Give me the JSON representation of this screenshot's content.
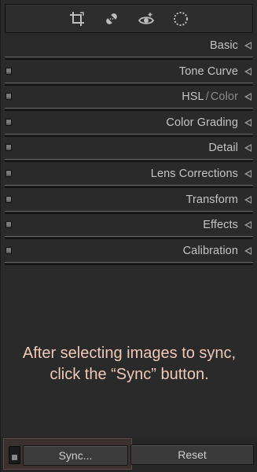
{
  "toolbar": {
    "tools": [
      {
        "icon": "crop-icon"
      },
      {
        "icon": "healing-bandage-icon"
      },
      {
        "icon": "red-eye-icon"
      },
      {
        "icon": "masking-circle-icon"
      }
    ]
  },
  "sections": [
    {
      "label": "Basic",
      "has_toggle": false
    },
    {
      "label": "Tone Curve",
      "has_toggle": true
    },
    {
      "label": "HSL",
      "label_alt": "Color",
      "has_toggle": true
    },
    {
      "label": "Color Grading",
      "has_toggle": true
    },
    {
      "label": "Detail",
      "has_toggle": true
    },
    {
      "label": "Lens Corrections",
      "has_toggle": true
    },
    {
      "label": "Transform",
      "has_toggle": true
    },
    {
      "label": "Effects",
      "has_toggle": true
    },
    {
      "label": "Calibration",
      "has_toggle": true
    }
  ],
  "tip": {
    "text": "After selecting images to sync, click the “Sync” button."
  },
  "bottom": {
    "sync_label": "Sync...",
    "reset_label": "Reset"
  },
  "colors": {
    "panel_bg": "#2a2a2a",
    "tip_text": "#f0c9b8",
    "highlight_border": "#5e4a48"
  }
}
